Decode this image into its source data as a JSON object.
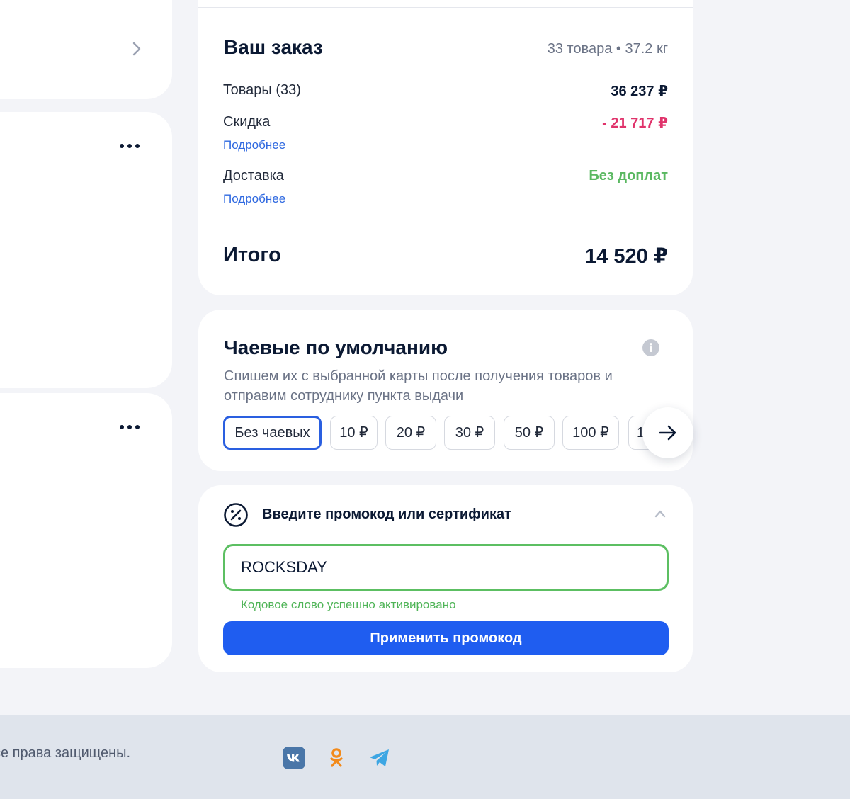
{
  "order": {
    "title": "Ваш заказ",
    "meta": "33 товара • 37.2 кг",
    "goods_label": "Товары (33)",
    "goods_value": "36 237 ₽",
    "discount_label": "Скидка",
    "discount_value": "- 21 717 ₽",
    "discount_link": "Подробнее",
    "delivery_label": "Доставка",
    "delivery_value": "Без доплат",
    "delivery_link": "Подробнее",
    "total_label": "Итого",
    "total_value": "14 520 ₽"
  },
  "tips": {
    "title": "Чаевые по умолчанию",
    "description": "Спишем их с выбранной карты после получения товаров и отправим сотруднику пункта выдачи",
    "options": [
      "Без чаевых",
      "10 ₽",
      "20 ₽",
      "30 ₽",
      "50 ₽",
      "100 ₽",
      "1"
    ],
    "selected": "Без чаевых"
  },
  "promo": {
    "title": "Введите промокод или сертификат",
    "value": "ROCKSDAY",
    "success": "Кодовое слово успешно активировано",
    "button": "Применить промокод"
  },
  "footer": {
    "copyright": "се права защищены."
  },
  "icons": {
    "left_top": "chevron-right-icon",
    "left_menu": "more-dots-icon",
    "tips_info": "info-icon",
    "tips_next": "arrow-right-icon",
    "promo": "discount-percent-icon",
    "promo_toggle": "chevron-up-icon",
    "social": [
      "vk-icon",
      "odnoklassniki-icon",
      "telegram-icon"
    ]
  },
  "colors": {
    "accent": "#1f5df0",
    "link": "#2e68e0",
    "discount": "#e0336b",
    "success": "#4fb457",
    "page_bg": "#f3f4f8",
    "footer_bg": "#dfe4ec"
  }
}
